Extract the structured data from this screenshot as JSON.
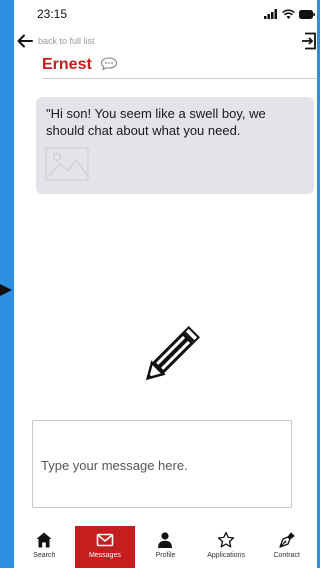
{
  "status_bar": {
    "time": "23:15"
  },
  "header": {
    "back_label": "back to full list",
    "contact_name": "Ernest"
  },
  "messages": [
    {
      "text": "\"Hi son! You seem like a swell boy, we should chat about what you need."
    }
  ],
  "composer": {
    "placeholder": "Type your message here."
  },
  "tabs": [
    {
      "label": "Search",
      "icon": "home-icon"
    },
    {
      "label": "Messages",
      "icon": "envelope-icon"
    },
    {
      "label": "Profile",
      "icon": "person-icon"
    },
    {
      "label": "Applications",
      "icon": "star-icon"
    },
    {
      "label": "Contract",
      "icon": "pen-nib-icon"
    }
  ],
  "colors": {
    "background": "#2f8fe0",
    "accent": "#c41e1e",
    "bubble": "#e3e3e9"
  }
}
